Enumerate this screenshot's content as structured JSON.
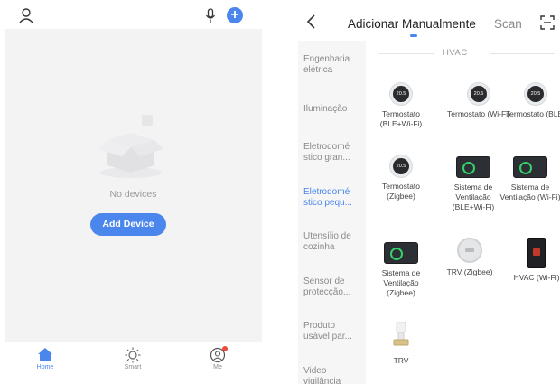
{
  "left": {
    "empty_text": "No devices",
    "add_device_label": "Add Device",
    "tabs": [
      {
        "label": "Home"
      },
      {
        "label": "Smart"
      },
      {
        "label": "Me"
      }
    ],
    "accent": "#4a86ec"
  },
  "right": {
    "title": "Adicionar Manualmente",
    "scan_label": "Scan",
    "section_title": "HVAC",
    "sidebar": [
      {
        "label": "Engenharia elétrica"
      },
      {
        "label": "Iluminação"
      },
      {
        "label": "Eletrodomé stico gran..."
      },
      {
        "label": "Eletrodomé stico pequ..."
      },
      {
        "label": "Utensílio de cozinha"
      },
      {
        "label": "Sensor de protecção..."
      },
      {
        "label": "Produto usável par..."
      },
      {
        "label": "Video vigilância"
      }
    ],
    "devices": [
      {
        "label": "Termostato (BLE+Wi-Fi)",
        "icon": "thermostat-icon",
        "reading": "20.5"
      },
      {
        "label": "Termostato (Wi-Fi)",
        "icon": "thermostat-icon",
        "reading": "20.5"
      },
      {
        "label": "Termostato (BLE)",
        "icon": "thermostat-icon",
        "reading": "20.5"
      },
      {
        "label": "Termostato (Zigbee)",
        "icon": "thermostat-icon",
        "reading": "20.5"
      },
      {
        "label": "Sistema de Ventilação (BLE+Wi-Fi)",
        "icon": "ventilation-icon"
      },
      {
        "label": "Sistema de Ventilação (Wi-Fi)",
        "icon": "ventilation-icon"
      },
      {
        "label": "Sistema de Ventilação (Zigbee)",
        "icon": "ventilation-icon"
      },
      {
        "label": "TRV (Zigbee)",
        "icon": "trv-icon"
      },
      {
        "label": "HVAC (Wi-Fi)",
        "icon": "hvac-icon"
      },
      {
        "label": "TRV",
        "icon": "valve-icon"
      }
    ]
  }
}
